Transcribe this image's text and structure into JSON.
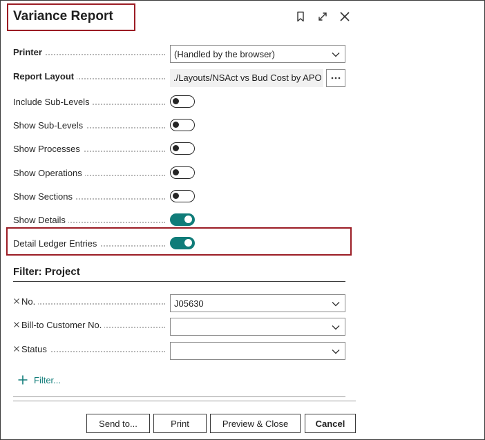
{
  "dialog": {
    "title": "Variance Report",
    "icons": [
      "bookmark-icon",
      "expand-icon",
      "close-icon"
    ]
  },
  "options": {
    "printer": {
      "label": "Printer",
      "value": "(Handled by the browser)"
    },
    "report_layout": {
      "label": "Report Layout",
      "value": "./Layouts/NSAct vs Bud Cost by APO...",
      "more_label": "···"
    },
    "toggles": [
      {
        "label": "Include Sub-Levels",
        "on": false
      },
      {
        "label": "Show Sub-Levels",
        "on": false
      },
      {
        "label": "Show Processes",
        "on": false
      },
      {
        "label": "Show Operations",
        "on": false
      },
      {
        "label": "Show Sections",
        "on": false
      },
      {
        "label": "Show Details",
        "on": true
      },
      {
        "label": "Detail Ledger Entries",
        "on": true
      }
    ]
  },
  "filter": {
    "title": "Filter: Project",
    "fields": [
      {
        "label": "No.",
        "value": "J05630"
      },
      {
        "label": "Bill-to Customer No.",
        "value": ""
      },
      {
        "label": "Status",
        "value": ""
      }
    ],
    "add_label": "Filter..."
  },
  "buttons": {
    "send_to": "Send to...",
    "print": "Print",
    "preview_close": "Preview & Close",
    "cancel": "Cancel"
  },
  "colors": {
    "accent": "#107c79",
    "highlight": "#9b1c24"
  }
}
